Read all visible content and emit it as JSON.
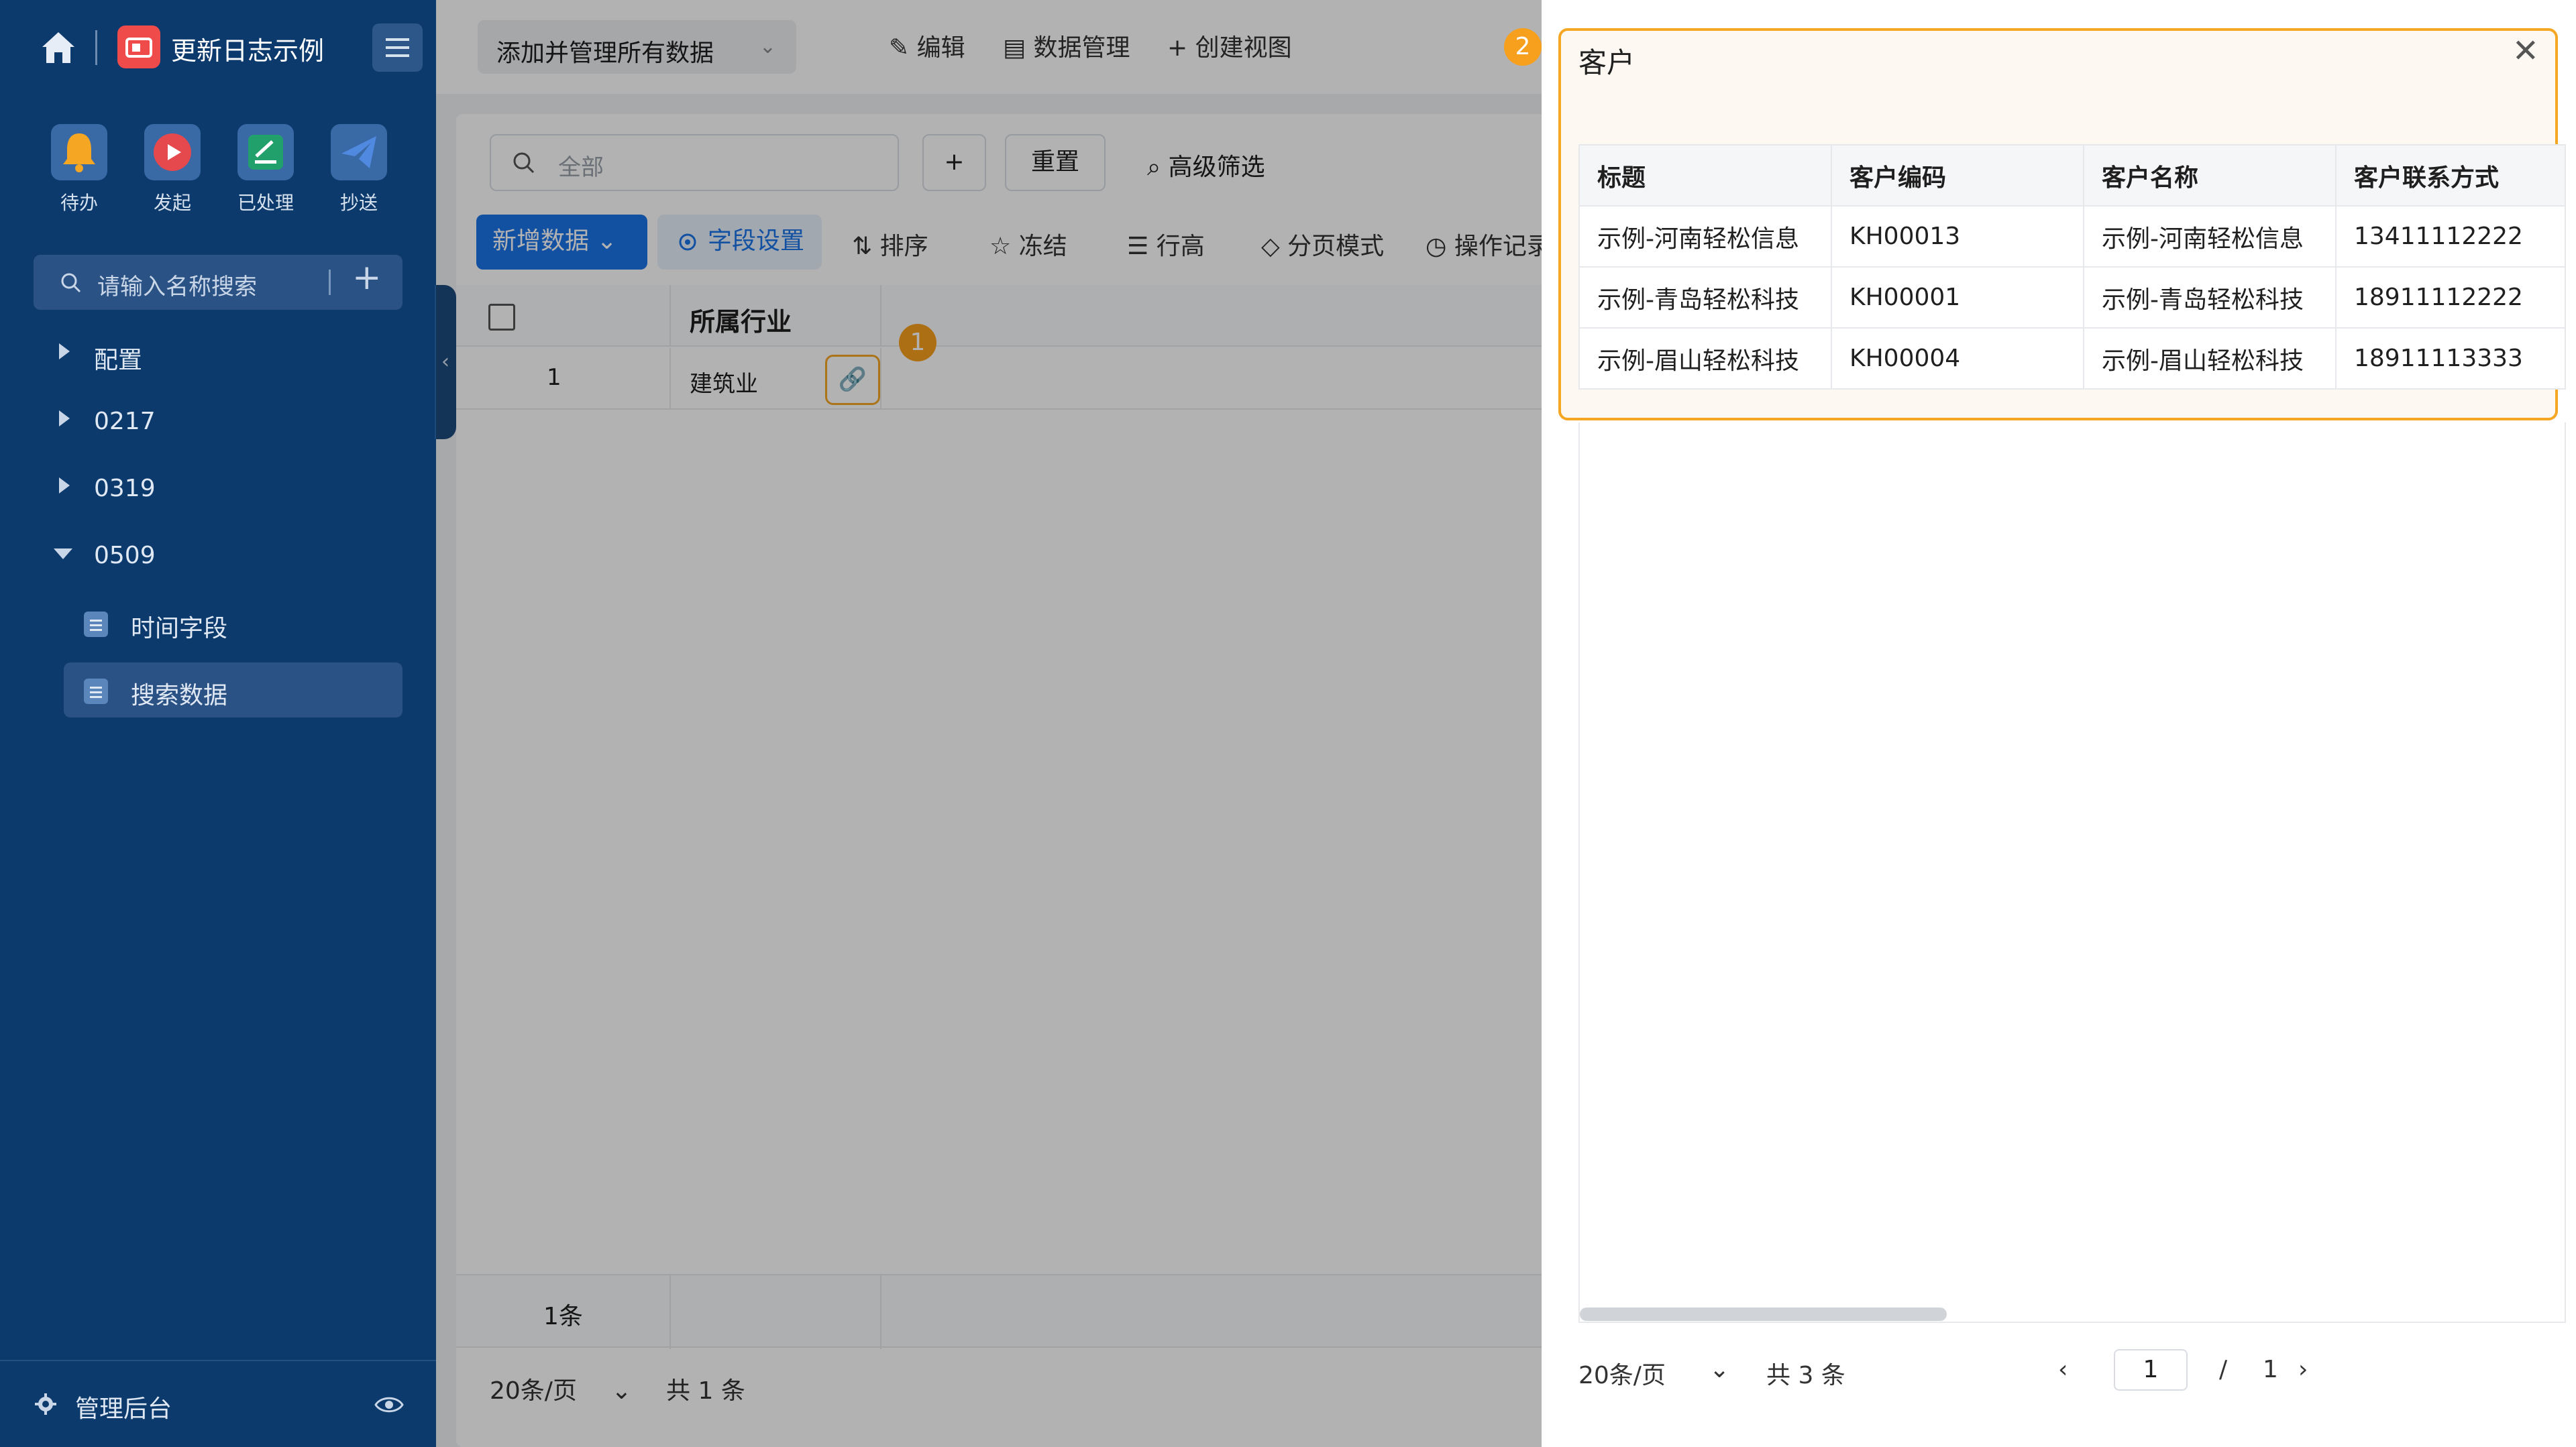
{
  "sidebar": {
    "app_title": "更新日志示例",
    "quick_actions": [
      {
        "label": "待办",
        "icon": "bell-icon",
        "color": "#f5a623"
      },
      {
        "label": "发起",
        "icon": "play-icon",
        "color": "#e5484d"
      },
      {
        "label": "已处理",
        "icon": "check-square-icon",
        "color": "#22a06b"
      },
      {
        "label": "抄送",
        "icon": "send-icon",
        "color": "#4f8ae0"
      }
    ],
    "search_placeholder": "请输入名称搜索",
    "tree": [
      {
        "label": "配置",
        "expanded": false
      },
      {
        "label": "0217",
        "expanded": false
      },
      {
        "label": "0319",
        "expanded": false
      },
      {
        "label": "0509",
        "expanded": true
      }
    ],
    "sub_items": [
      "时间字段",
      "搜索数据"
    ],
    "selected_sub_item": "搜索数据",
    "footer_label": "管理后台"
  },
  "topbar": {
    "view_select": "添加并管理所有数据",
    "edit": "编辑",
    "data_manage": "数据管理",
    "create_view": "+ 创建视图"
  },
  "filter": {
    "search_placeholder": "全部",
    "add": "+",
    "reset": "重置",
    "advanced": "高级筛选"
  },
  "toolbar": {
    "new_data": "新增数据",
    "field_settings": "字段设置",
    "sort": "排序",
    "freeze": "冻结",
    "row_height": "行高",
    "paging_mode": "分页模式",
    "op_log": "操作记录"
  },
  "grid": {
    "column": "所属行业",
    "rows": [
      {
        "index": "1",
        "industry": "建筑业"
      }
    ],
    "summary_count": "1条",
    "page_size": "20条/页",
    "total": "共 1 条"
  },
  "badges": {
    "one": "1",
    "two": "2"
  },
  "drawer": {
    "title": "客户",
    "close": "✕",
    "columns": [
      "标题",
      "客户编码",
      "客户名称",
      "客户联系方式"
    ],
    "rows": [
      [
        "示例-河南轻松信息",
        "KH00013",
        "示例-河南轻松信息",
        "13411112222"
      ],
      [
        "示例-青岛轻松科技",
        "KH00001",
        "示例-青岛轻松科技",
        "18911112222"
      ],
      [
        "示例-眉山轻松科技",
        "KH00004",
        "示例-眉山轻松科技",
        "18911113333"
      ]
    ],
    "page_size": "20条/页",
    "total": "共 3 条",
    "current_page": "1",
    "page_sep": "/",
    "total_pages": "1"
  },
  "colors": {
    "accent": "#1a73e8",
    "highlight": "#f5a623",
    "sidebar": "#0c3a6c"
  }
}
